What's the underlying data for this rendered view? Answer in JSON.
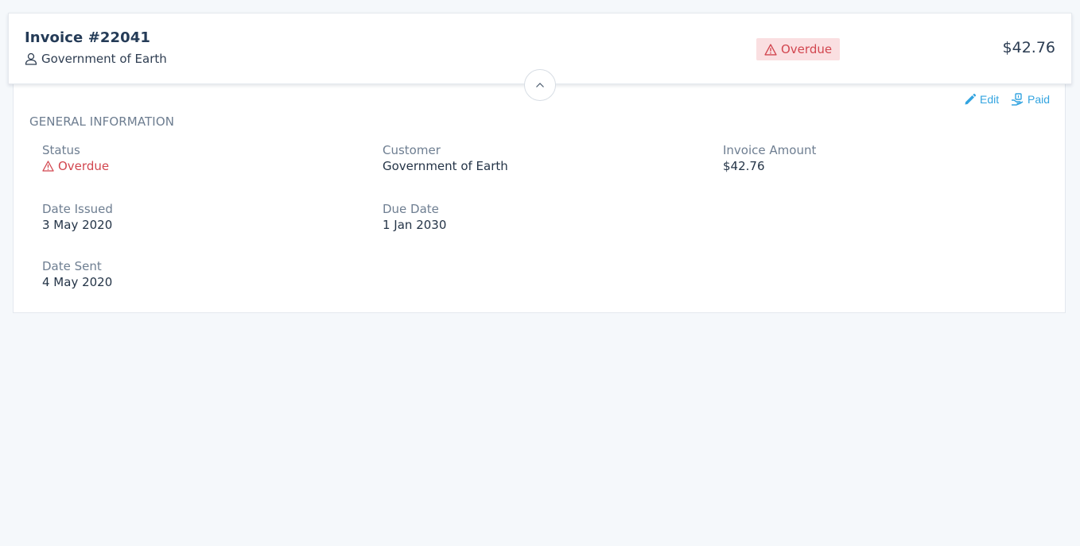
{
  "header": {
    "title": "Invoice #22041",
    "customer": "Government of Earth",
    "status": "Overdue",
    "amount": "$42.76"
  },
  "actions": {
    "edit_label": "Edit",
    "paid_label": "Paid"
  },
  "section": {
    "title": "GENERAL INFORMATION",
    "fields": {
      "status": {
        "label": "Status",
        "value": "Overdue"
      },
      "customer": {
        "label": "Customer",
        "value": "Government of Earth"
      },
      "invoice_amount": {
        "label": "Invoice Amount",
        "value": "$42.76"
      },
      "date_issued": {
        "label": "Date Issued",
        "value": "3 May 2020"
      },
      "due_date": {
        "label": "Due Date",
        "value": "1 Jan 2030"
      },
      "date_sent": {
        "label": "Date Sent",
        "value": "4 May 2020"
      }
    }
  },
  "icons": {
    "customer": "user-icon",
    "status": "warning-triangle-icon",
    "toggle": "chevron-up-icon",
    "edit": "pencil-icon",
    "paid": "hand-money-icon"
  },
  "colors": {
    "accent": "#33a4e0",
    "danger": "#d2464f",
    "danger_bg": "#fadfe1"
  }
}
